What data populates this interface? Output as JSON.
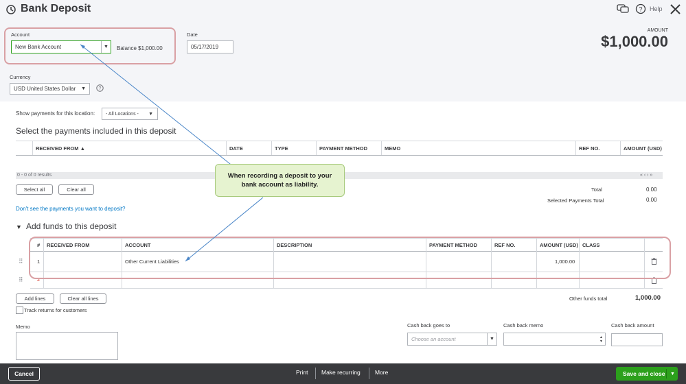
{
  "header": {
    "title": "Bank Deposit",
    "help_label": "Help",
    "amount_label": "AMOUNT",
    "amount_value": "$1,000.00"
  },
  "account": {
    "label": "Account",
    "value": "New Bank Account",
    "balance": "Balance $1,000.00"
  },
  "date": {
    "label": "Date",
    "value": "05/17/2019"
  },
  "currency": {
    "label": "Currency",
    "value": "USD United States Dollar"
  },
  "payments": {
    "location_label": "Show payments for this location:",
    "location_value": "- All Locations -",
    "heading": "Select the payments included in this deposit",
    "columns": [
      "RECEIVED FROM ▲",
      "DATE",
      "TYPE",
      "PAYMENT METHOD",
      "MEMO",
      "REF NO.",
      "AMOUNT (USD)"
    ],
    "results": "0 - 0 of 0 results",
    "pager": "« ‹ › »",
    "select_all": "Select all",
    "clear_all": "Clear all",
    "total_label": "Total",
    "total_value": "0.00",
    "selected_total_label": "Selected Payments Total",
    "selected_total_value": "0.00",
    "missing_link": "Don't see the payments you want to deposit?"
  },
  "funds": {
    "heading": "Add funds to this deposit",
    "columns": [
      "#",
      "RECEIVED FROM",
      "ACCOUNT",
      "DESCRIPTION",
      "PAYMENT METHOD",
      "REF NO.",
      "AMOUNT (USD)",
      "CLASS"
    ],
    "rows": [
      {
        "num": "1",
        "account": "Other Current Liabilities",
        "amount": "1,000.00"
      },
      {
        "num": "2",
        "account": "",
        "amount": ""
      }
    ],
    "add_lines": "Add lines",
    "clear_all_lines": "Clear all lines",
    "track_returns": "Track returns for customers",
    "other_total_label": "Other funds total",
    "other_total_value": "1,000.00"
  },
  "memo": {
    "label": "Memo"
  },
  "cashback": {
    "goes_to_label": "Cash back goes to",
    "goes_to_placeholder": "Choose an account",
    "memo_label": "Cash back memo",
    "amount_label": "Cash back amount"
  },
  "callout": {
    "text": "When recording a deposit to your bank account  as liability."
  },
  "footer": {
    "cancel": "Cancel",
    "print": "Print",
    "recurring": "Make recurring",
    "more": "More",
    "save_close": "Save and close"
  },
  "colors": {
    "accent_green": "#2ca01c",
    "dark_bar": "#393a3d",
    "link": "#0077c5"
  }
}
